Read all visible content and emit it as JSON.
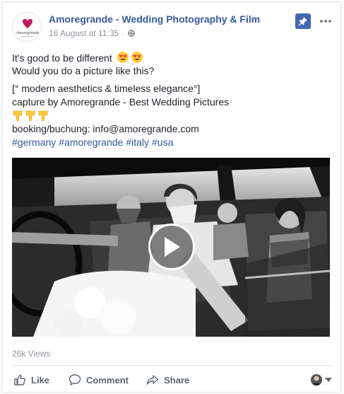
{
  "post": {
    "page_name": "Amoregrande - Wedding Photography & Film",
    "timestamp": "16 August at 11:35",
    "separator": "·",
    "logo_text": "Amoregrande",
    "text_lines": [
      "It's good to be different",
      "Would you do a picture like this?",
      "[° modern aesthetics & timeless elegance°]",
      "capture by Amoregrande - Best Wedding Pictures",
      "booking/buchung: info@amoregrande.com"
    ],
    "hashtags": [
      "#germany",
      "#amoregrande",
      "#italy",
      "#usa"
    ],
    "emojis": [
      "heart-eyes",
      "heart-eyes",
      "point-down",
      "point-down",
      "point-down"
    ],
    "views": "26k Views"
  },
  "actions": {
    "like_label": "Like",
    "comment_label": "Comment",
    "share_label": "Share"
  },
  "colors": {
    "link": "#365899",
    "pin": "#4267b2",
    "muted": "#90949c",
    "text": "#1d2129",
    "brand_pink": "#c2185b"
  }
}
